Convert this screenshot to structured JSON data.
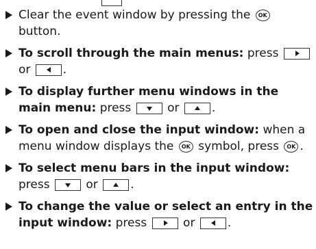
{
  "ok_label": "OK",
  "icons": {
    "bullet": "right-triangle",
    "ok": "ok-button-circle",
    "right": "right-arrow-key",
    "left": "left-arrow-key",
    "down": "down-arrow-key",
    "up": "up-arrow-key"
  },
  "items": [
    {
      "pre": "Clear the event window by pressing the",
      "post": "button."
    },
    {
      "bold": "To scroll through the main menus:",
      "text": "press",
      "or": "or"
    },
    {
      "bold": "To display further menu windows in the main menu:",
      "text": "press",
      "or": "or"
    },
    {
      "bold": "To open and close the input window:",
      "text": "when a menu window displays the",
      "post": "symbol, press"
    },
    {
      "bold": "To select menu bars in the input window:",
      "text": "press",
      "or": "or"
    },
    {
      "bold": "To change the value or select an entry in the input window:",
      "text": "press",
      "or": "or"
    }
  ]
}
